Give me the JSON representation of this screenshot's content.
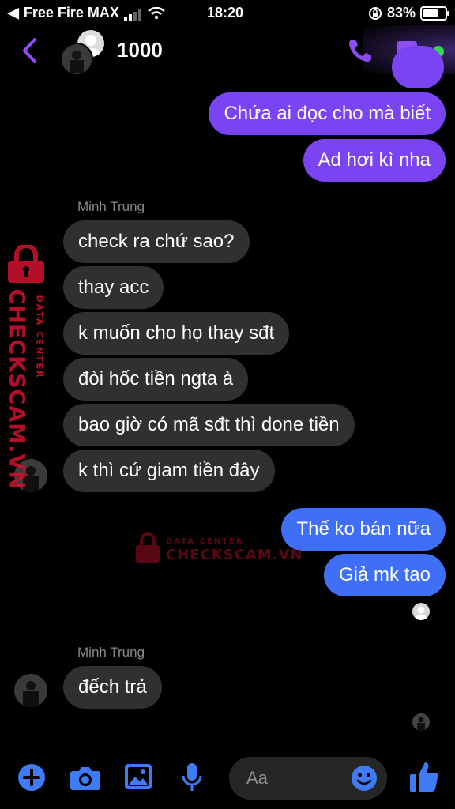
{
  "status_bar": {
    "carrier": "Free Fire MAX",
    "time": "18:20",
    "battery_text": "83%",
    "battery_level": 0.83
  },
  "header": {
    "title": "1000",
    "back_icon": "chevron-left-icon",
    "call_icon": "phone-icon",
    "video_icon": "video-camera-icon"
  },
  "messages": [
    {
      "dir": "out",
      "text": "Chứa ai đọc cho mà biết"
    },
    {
      "dir": "out",
      "text": "Ad hơi kì nha"
    },
    {
      "dir": "in",
      "sender": "Minh Trung",
      "text": "check ra chứ sao?"
    },
    {
      "dir": "in",
      "text": "thay acc"
    },
    {
      "dir": "in",
      "text": "k muốn cho họ thay sđt"
    },
    {
      "dir": "in",
      "text": "đòi hốc tiền ngta à"
    },
    {
      "dir": "in",
      "text": "bao giờ có mã sđt thì done tiền"
    },
    {
      "dir": "in",
      "text": "k thì cứ giam tiền đây"
    },
    {
      "dir": "out",
      "text": "Thế ko bán nữa"
    },
    {
      "dir": "out",
      "text": "Giả mk tao"
    },
    {
      "dir": "in",
      "sender": "Minh Trung",
      "text": "đếch trả"
    }
  ],
  "watermark": {
    "line1": "DATA CENTER",
    "line2": "CHECKSCAM.VN",
    "color": "#c8102e"
  },
  "composer": {
    "placeholder": "Aa",
    "icons": [
      "plus-icon",
      "camera-icon",
      "image-icon",
      "microphone-icon",
      "emoji-icon",
      "thumbs-up-icon"
    ]
  },
  "colors": {
    "accent_purple": "#7a44f2",
    "accent_blue": "#3e6ff6",
    "incoming": "#303030"
  }
}
